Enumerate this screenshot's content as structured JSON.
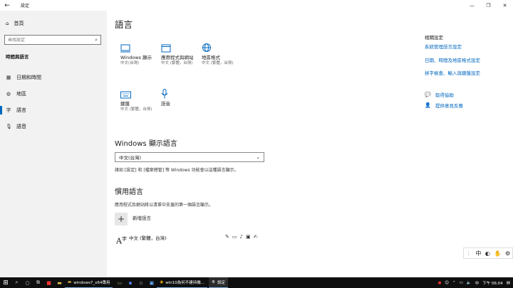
{
  "window": {
    "title": "設定"
  },
  "sidebar": {
    "home_label": "首頁",
    "search_placeholder": "尋找設定",
    "section_title": "時間與語言",
    "items": [
      {
        "label": "日期和時間",
        "icon": "calendar-icon"
      },
      {
        "label": "地區",
        "icon": "globe-icon"
      },
      {
        "label": "語言",
        "icon": "language-icon"
      },
      {
        "label": "語音",
        "icon": "microphone-icon"
      }
    ]
  },
  "main": {
    "title": "語言",
    "tiles": [
      {
        "label": "Windows 顯示",
        "sub": "中文(台灣)"
      },
      {
        "label": "應用程式與網站",
        "sub": "中文 (繁體，台灣)"
      },
      {
        "label": "地區格式",
        "sub": "中文 (繁體，台灣)"
      },
      {
        "label": "鍵盤",
        "sub": "中文 (繁體，台灣)"
      },
      {
        "label": "語音",
        "sub": ""
      }
    ],
    "display_language": {
      "title": "Windows 顯示語言",
      "selected": "中文(台灣)",
      "description": "諸如 [設定] 和 [檔案總管] 等 Windows 功能會以這種語言顯示。"
    },
    "preferred": {
      "title": "慣用語言",
      "description": "應用程式及網站將以清單中支援的第一個語言顯示。",
      "add_label": "新增語言",
      "language_name": "中文 (繁體，台灣)"
    }
  },
  "related": {
    "title": "相關設定",
    "links": [
      "系統管理語言設定",
      "日期、時間及地區格式設定",
      "拼字檢查、輸入與鍵盤設定"
    ],
    "help": [
      {
        "label": "取得協助",
        "icon": "help-chat-icon"
      },
      {
        "label": "提供意見反應",
        "icon": "feedback-icon"
      }
    ]
  },
  "ime": {
    "mode": "中"
  },
  "taskbar": {
    "apps": [
      {
        "label": "windows7_x64專用"
      },
      {
        "label": "win10為何不建持機..."
      },
      {
        "label": "設定"
      }
    ],
    "clock": "下午 06:04"
  }
}
